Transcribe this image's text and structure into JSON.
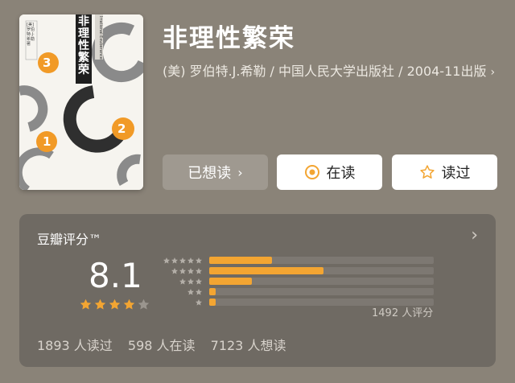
{
  "book": {
    "title": "非理性繁荣",
    "meta": "(美) 罗伯特.J.希勒 / 中国人民大学出版社 / 2004-11出版",
    "meta_chevron": "›",
    "cover": {
      "vertical_title": "非理性繁荣",
      "author_line": "[美] 罗伯特·J·希勒 著",
      "english_title": "Irrational Exuberance",
      "numbers": [
        "3",
        "2",
        "1"
      ]
    }
  },
  "actions": {
    "wished": {
      "label": "已想读",
      "chevron": "›"
    },
    "reading": {
      "label": "在读",
      "icon": "circle-dot-icon"
    },
    "read": {
      "label": "读过",
      "icon": "star-outline-icon"
    }
  },
  "rating": {
    "title": "豆瓣评分™",
    "chevron": "›",
    "score": "8.1",
    "stars_filled": 4,
    "stars_total": 5,
    "distribution": [
      {
        "stars": 5,
        "fraction": 0.28
      },
      {
        "stars": 4,
        "fraction": 0.51
      },
      {
        "stars": 3,
        "fraction": 0.19
      },
      {
        "stars": 2,
        "fraction": 0.03
      },
      {
        "stars": 1,
        "fraction": 0.03
      }
    ],
    "count_label": "1492 人评分"
  },
  "stats": {
    "read": "1893 人读过",
    "reading": "598 人在读",
    "wished": "7123 人想读"
  },
  "colors": {
    "accent": "#f3a532",
    "background": "#8a8378",
    "panel": "#6f6a63"
  }
}
